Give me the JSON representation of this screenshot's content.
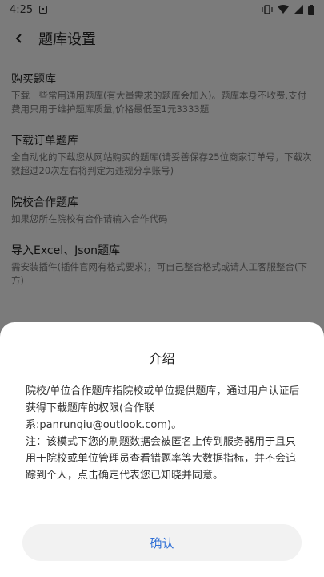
{
  "status": {
    "time": "4:25",
    "icons": [
      "notification-a-icon",
      "vibrate-icon",
      "wifi-icon",
      "signal-icon",
      "battery-icon"
    ]
  },
  "header": {
    "back_icon": "chevron-left",
    "title": "题库设置"
  },
  "list": {
    "items": [
      {
        "title": "购买题库",
        "desc": "下载一些常用通用题库(有大量需求的题库会加入)。题库本身不收费,支付费用只用于维护题库质量,价格最低至1元3333题"
      },
      {
        "title": "下载订单题库",
        "desc": "全自动化的下载您从网站购买的题库(请妥善保存25位商家订单号，下载次数超过20次左右将判定为违规分享账号)"
      },
      {
        "title": "院校合作题库",
        "desc": "如果您所在院校有合作请输入合作代码"
      },
      {
        "title": "导入Excel、Json题库",
        "desc": "需安装插件(插件官网有格式要求)，可自己整合格式或请人工客服整合(下方)"
      }
    ]
  },
  "dialog": {
    "title": "介绍",
    "paragraph1": "院校/单位合作题库指院校或单位提供题库，通过用户认证后获得下载题库的权限(合作联系:panrunqiu@outlook.com)。",
    "paragraph2": "注：该模式下您的刷题数据会被匿名上传到服务器用于且只用于院校或单位管理员查看错题率等大数据指标，并不会追踪到个人，点击确定代表您已知晓并同意。",
    "confirm_label": "确认"
  },
  "colors": {
    "accent": "#2f6fd6",
    "scrim": "rgba(0,0,0,0.5)"
  }
}
